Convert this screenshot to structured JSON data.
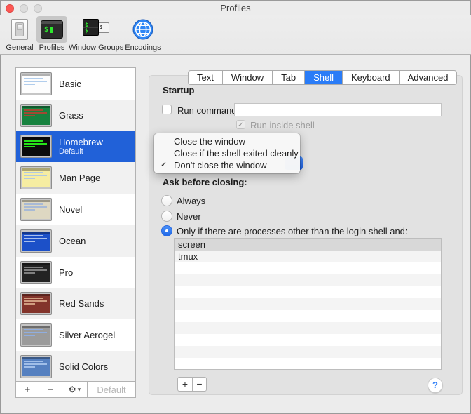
{
  "window": {
    "title": "Profiles"
  },
  "icons": {
    "check": "✓",
    "gear": "⚙",
    "chevron_down": "▾",
    "help": "?",
    "prompt": "$",
    "prompt_small": "$|"
  },
  "toolbar": {
    "items": [
      {
        "label": "General"
      },
      {
        "label": "Profiles",
        "selected": true
      },
      {
        "label": "Window Groups"
      },
      {
        "label": "Encodings"
      }
    ]
  },
  "sidebar": {
    "profiles": [
      {
        "name": "Basic",
        "thumb_bg": "#fdfdfd",
        "thumb_accent": "#a8c8ea"
      },
      {
        "name": "Grass",
        "thumb_bg": "#17823f",
        "thumb_accent": "#b04232"
      },
      {
        "name": "Homebrew",
        "subtitle": "Default",
        "selected": true,
        "thumb_bg": "#0b0b0b",
        "thumb_accent": "#29fb1b"
      },
      {
        "name": "Man Page",
        "thumb_bg": "#f6eda2",
        "thumb_accent": "#a9c4e8"
      },
      {
        "name": "Novel",
        "thumb_bg": "#ded8c2",
        "thumb_accent": "#a2b7d8"
      },
      {
        "name": "Ocean",
        "thumb_bg": "#1c50c8",
        "thumb_accent": "#b8cbf0"
      },
      {
        "name": "Pro",
        "thumb_bg": "#232323",
        "thumb_accent": "#8a8a8a"
      },
      {
        "name": "Red Sands",
        "thumb_bg": "#83342b",
        "thumb_accent": "#d8a88a"
      },
      {
        "name": "Silver Aerogel",
        "thumb_bg": "#9b9b9b",
        "thumb_accent": "#8fb0e8"
      },
      {
        "name": "Solid Colors",
        "thumb_bg": "#5580c0",
        "thumb_accent": "#a8c4ec"
      }
    ],
    "buttons": {
      "add": "+",
      "remove": "−",
      "default_label": "Default"
    }
  },
  "tabs": {
    "items": [
      "Text",
      "Window",
      "Tab",
      "Shell",
      "Keyboard",
      "Advanced"
    ],
    "selected": "Shell"
  },
  "shell_pane": {
    "startup": {
      "heading": "Startup",
      "run_command_label": "Run command:",
      "run_command_value": "",
      "run_inside_shell_label": "Run inside shell",
      "run_inside_shell_checked": true
    },
    "menu": {
      "items": [
        {
          "label": "Close the window"
        },
        {
          "label": "Close if the shell exited cleanly"
        },
        {
          "label": "Don't close the window",
          "checked": true
        }
      ]
    },
    "ask_before_closing": {
      "heading": "Ask before closing:",
      "options": [
        {
          "label": "Always"
        },
        {
          "label": "Never"
        },
        {
          "label": "Only if there are processes other than the login shell and:",
          "selected": true
        }
      ],
      "processes": [
        "screen",
        "tmux"
      ]
    },
    "list_buttons": {
      "add": "+",
      "remove": "−"
    }
  },
  "colors": {
    "accent_blue": "#2a7cf7",
    "sidebar_selection_blue": "#2161d8",
    "popup_button_blue": "#1d5fe0",
    "window_bg": "#ececec",
    "groupbox_bg": "#e2e2e2",
    "close_button_red": "#fc5753"
  }
}
